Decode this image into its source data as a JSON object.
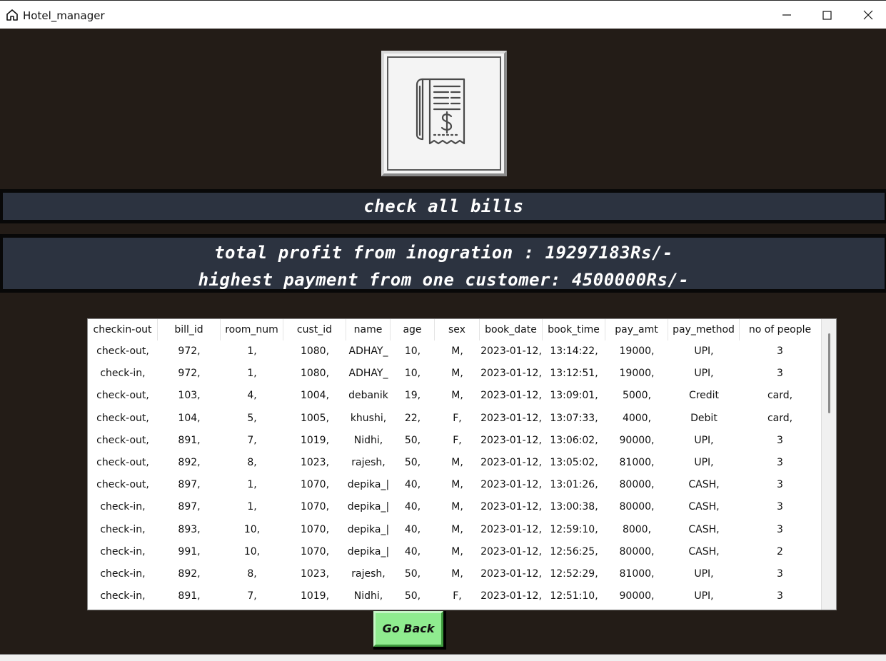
{
  "window": {
    "title": "Hotel_manager"
  },
  "header": {
    "banner_title": "check all bills",
    "summary_line1": "total profit from inogration : 19297183Rs/-",
    "summary_line2": "highest payment from one customer: 4500000Rs/-"
  },
  "table": {
    "columns": [
      "checkin-out",
      "bill_id",
      "room_num",
      "cust_id",
      "name",
      "age",
      "sex",
      "book_date",
      "book_time",
      "pay_amt",
      "pay_method",
      "no of people"
    ],
    "rows": [
      [
        "check-out,",
        "972,",
        "1,",
        "1080,",
        "ADHAY_",
        "10,",
        "M,",
        "2023-01-12,",
        "13:14:22,",
        "19000,",
        "UPI,",
        "3"
      ],
      [
        "check-in,",
        "972,",
        "1,",
        "1080,",
        "ADHAY_",
        "10,",
        "M,",
        "2023-01-12,",
        "13:12:51,",
        "19000,",
        "UPI,",
        "3"
      ],
      [
        "check-out,",
        "103,",
        "4,",
        "1004,",
        "debanik",
        "19,",
        "M,",
        "2023-01-12,",
        "13:09:01,",
        "5000,",
        "Credit",
        "card,"
      ],
      [
        "check-out,",
        "104,",
        "5,",
        "1005,",
        "khushi,",
        "22,",
        "F,",
        "2023-01-12,",
        "13:07:33,",
        "4000,",
        "Debit",
        "card,"
      ],
      [
        "check-out,",
        "891,",
        "7,",
        "1019,",
        "Nidhi,",
        "50,",
        "F,",
        "2023-01-12,",
        "13:06:02,",
        "90000,",
        "UPI,",
        "3"
      ],
      [
        "check-out,",
        "892,",
        "8,",
        "1023,",
        "rajesh,",
        "50,",
        "M,",
        "2023-01-12,",
        "13:05:02,",
        "81000,",
        "UPI,",
        "3"
      ],
      [
        "check-out,",
        "897,",
        "1,",
        "1070,",
        "depika_|",
        "40,",
        "M,",
        "2023-01-12,",
        "13:01:26,",
        "80000,",
        "CASH,",
        "3"
      ],
      [
        "check-in,",
        "897,",
        "1,",
        "1070,",
        "depika_|",
        "40,",
        "M,",
        "2023-01-12,",
        "13:00:38,",
        "80000,",
        "CASH,",
        "3"
      ],
      [
        "check-in,",
        "893,",
        "10,",
        "1070,",
        "depika_|",
        "40,",
        "M,",
        "2023-01-12,",
        "12:59:10,",
        "8000,",
        "CASH,",
        "3"
      ],
      [
        "check-in,",
        "991,",
        "10,",
        "1070,",
        "depika_|",
        "40,",
        "M,",
        "2023-01-12,",
        "12:56:25,",
        "80000,",
        "CASH,",
        "2"
      ],
      [
        "check-in,",
        "892,",
        "8,",
        "1023,",
        "rajesh,",
        "50,",
        "M,",
        "2023-01-12,",
        "12:52:29,",
        "81000,",
        "UPI,",
        "3"
      ],
      [
        "check-in,",
        "891,",
        "7,",
        "1019,",
        "Nidhi,",
        "50,",
        "F,",
        "2023-01-12,",
        "12:51:10,",
        "90000,",
        "UPI,",
        "3"
      ]
    ]
  },
  "buttons": {
    "go_back": "Go Back"
  },
  "icons": {
    "app": "home-icon",
    "logo": "bill-receipt-icon"
  },
  "colors": {
    "background": "#231c17",
    "banner": "#2c3340",
    "button": "#8fec8f"
  }
}
